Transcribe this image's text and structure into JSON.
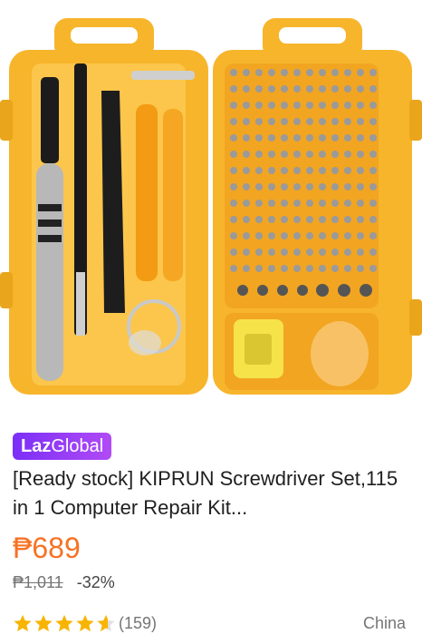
{
  "product": {
    "badge_part1": "Laz",
    "badge_part2": "Global",
    "title": "[Ready stock] KIPRUN Screwdriver Set,115 in 1 Computer Repair Kit...",
    "price": "₱689",
    "original_price": "₱1,011",
    "discount": "-32%",
    "rating_value": 4.5,
    "review_count": "(159)",
    "origin": "China",
    "image_icon": "screwdriver-set-product-image"
  },
  "colors": {
    "brand_price": "#f57224",
    "case_yellow": "#f7b52c",
    "badge_start": "#7b2ff7",
    "badge_end": "#b14bf5",
    "star": "#f8b400"
  }
}
